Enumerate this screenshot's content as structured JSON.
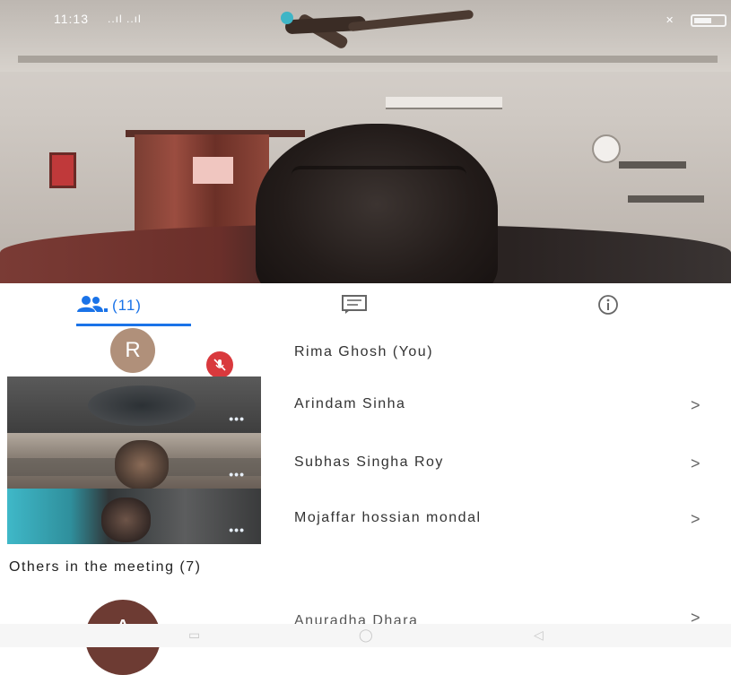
{
  "status_bar": {
    "time": "11:13",
    "signal_text": "..ıl ..ıl",
    "battery_label": "",
    "battery_level": 0.6
  },
  "tabs": {
    "people_count": "(11)",
    "people_icon": "people-icon",
    "chat_icon": "chat-icon",
    "info_icon": "info-icon",
    "accent_color": "#1a73e8"
  },
  "participants": [
    {
      "name": "Rima Ghosh (You)",
      "avatar_letter": "R",
      "avatar_color": "#b0907a",
      "muted": true
    },
    {
      "name": "Arindam Sinha",
      "chevron": ">"
    },
    {
      "name": "Subhas Singha Roy",
      "chevron": ">"
    },
    {
      "name": "Mojaffar hossian mondal",
      "chevron": ">"
    }
  ],
  "thumb_dots": "•••",
  "others": {
    "heading": "Others in the meeting (7)",
    "first": {
      "name": "Anuradha Dhara",
      "avatar_letter": "A",
      "chevron": ">"
    }
  },
  "nav": {
    "recents": "▭",
    "home": "◯",
    "back": "◁"
  }
}
